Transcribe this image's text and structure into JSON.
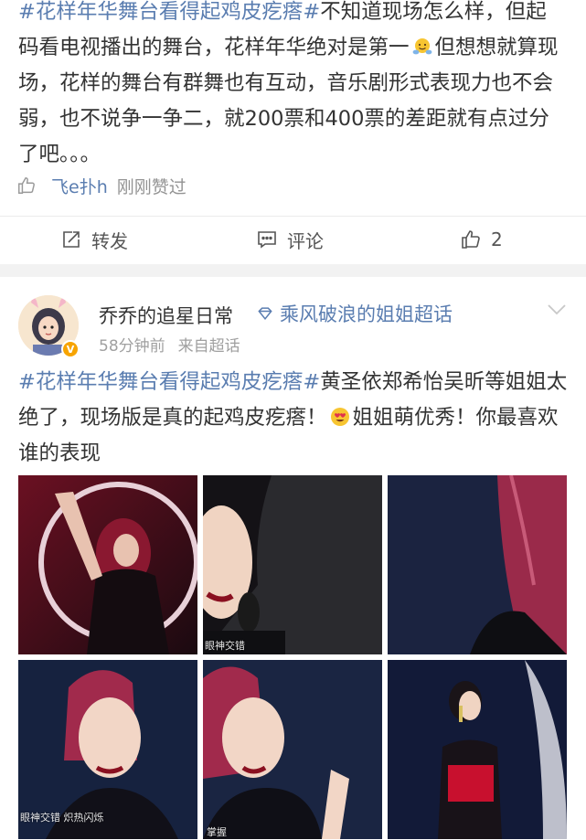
{
  "post1": {
    "hashtag": "#花样年华舞台看得起鸡皮疙瘩#",
    "text_a": "不知道现场怎么样，但起码看电视播出的舞台，花样年华绝对是第一",
    "text_b": "但想想就算现场，花样的舞台有群舞也有互动，音乐剧形式表现力也不会弱，也不说争一争二，就200票和400票的差距就有点过分了吧。。。",
    "liked_user": "飞e扑h",
    "liked_text": "刚刚赞过"
  },
  "actions": {
    "repost_label": "转发",
    "comment_label": "评论",
    "like_count": "2"
  },
  "post2": {
    "username": "乔乔的追星日常",
    "topic": "乘风破浪的姐姐超话",
    "time": "58分钟前",
    "source": "来自超话",
    "badge": "V",
    "hashtag": "#花样年华舞台看得起鸡皮疙瘩#",
    "text_a": "黄圣依郑希怡吴昕等姐姐太绝了，现场版是真的起鸡皮疙瘩！",
    "text_b": "姐姐萌优秀！你最喜欢谁的表现",
    "images": [
      {
        "watermark": ""
      },
      {
        "watermark": "眼神交错"
      },
      {
        "watermark": ""
      },
      {
        "watermark": "眼神交错 炽热闪烁"
      },
      {
        "watermark": "掌握"
      },
      {
        "watermark": ""
      }
    ]
  },
  "colors": {
    "link_blue": "#5a7db0",
    "text": "#333333",
    "meta_gray": "#a0a0a0",
    "badge_orange": "#f7a400"
  }
}
